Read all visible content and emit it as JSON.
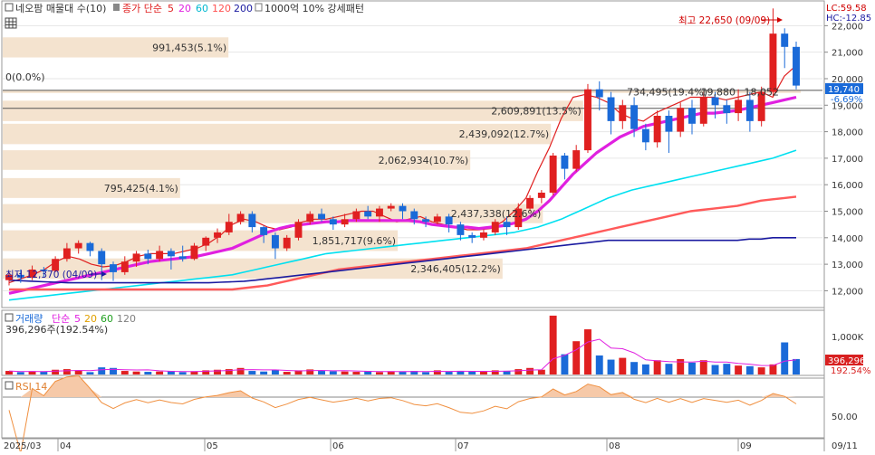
{
  "legend": {
    "ticker": "네오팜 매물대 수(10)",
    "ma_prefix": "종가 단순",
    "ma_periods": [
      "5",
      "20",
      "60",
      "120",
      "200"
    ],
    "ma_colors": [
      "#e02020",
      "#e020e0",
      "#00c8e0",
      "#ff5050",
      "#1a1aa0"
    ],
    "extra": "1000억 10% 강세패턴"
  },
  "corner": {
    "lc": "LC:59.58",
    "hc": "HC:-12.85"
  },
  "annotations": {
    "high": "최고 22,650 (09/09)",
    "low": "최저 12,370 (04/09)",
    "zero_profile": "0(0.0%)"
  },
  "price_badge": {
    "price": "19,740",
    "change": "-6.69%"
  },
  "volume_badge": {
    "value": "396,296",
    "pct": "192.54%"
  },
  "volume_legend": {
    "label": "거래량",
    "ma_prefix": "단순",
    "periods": [
      "5",
      "20",
      "60",
      "120"
    ],
    "colors": [
      "#e020e0",
      "#e0a000",
      "#20a020",
      "#808080"
    ],
    "summary": "396,296주(192.54%)"
  },
  "rsi_legend": {
    "label": "RSI 14"
  },
  "volume_axis": [
    "1,000K"
  ],
  "rsi_axis": [
    "50.00"
  ],
  "x_axis": [
    "2025/03",
    "04",
    "05",
    "06",
    "07",
    "08",
    "09",
    "09/11"
  ],
  "chart_data": {
    "type": "candlestick",
    "y_axis_ticks": [
      12000,
      13000,
      14000,
      15000,
      16000,
      17000,
      18000,
      19000,
      20000,
      21000,
      22000
    ],
    "ylim": [
      11400,
      22900
    ],
    "volume_profile": [
      {
        "label": "991,453(5.1%)",
        "y_from": 20800,
        "y_to": 21560,
        "width": 0.28
      },
      {
        "label": "734,495(19.4%)",
        "y_from": 19460,
        "y_to": 19560,
        "width": 0.99
      },
      {
        "label": "19,880",
        "y_from": 19460,
        "y_to": 19560,
        "width": 0.0
      },
      {
        "label": "18,052",
        "y_from": 19460,
        "y_to": 19560,
        "width": 0.0
      },
      {
        "label": "2,609,891(13.5%)",
        "y_from": 18400,
        "y_to": 19170,
        "width": 0.72
      },
      {
        "label": "2,439,092(12.7%)",
        "y_from": 17530,
        "y_to": 18300,
        "width": 0.68
      },
      {
        "label": "2,062,934(10.7%)",
        "y_from": 16560,
        "y_to": 17300,
        "width": 0.58
      },
      {
        "label": "795,425(4.1%)",
        "y_from": 15500,
        "y_to": 16250,
        "width": 0.22
      },
      {
        "label": "2,437,338(12.6%)",
        "y_from": 14550,
        "y_to": 15270,
        "width": 0.67
      },
      {
        "label": "1,851,717(9.6%)",
        "y_from": 13500,
        "y_to": 14280,
        "width": 0.49
      },
      {
        "label": "2,346,405(12.2%)",
        "y_from": 12450,
        "y_to": 13220,
        "width": 0.62
      }
    ],
    "box_levels": [
      19560,
      18880
    ],
    "series": [
      {
        "name": "5",
        "color": "#e02020",
        "values": [
          12300,
          12450,
          12600,
          12800,
          13100,
          13300,
          13200,
          13000,
          12900,
          12950,
          13100,
          13300,
          13400,
          13400,
          13400,
          13500,
          13600,
          13800,
          14100,
          14500,
          14700,
          14600,
          14400,
          14300,
          14400,
          14600,
          14700,
          14700,
          14800,
          14900,
          15000,
          15000,
          14800,
          14600,
          14700,
          14800,
          14600,
          14500,
          14400,
          14300,
          14300,
          14350,
          14600,
          15000,
          15500,
          16500,
          17400,
          18500,
          19300,
          19400,
          19300,
          19100,
          18700,
          18500,
          18400,
          18700,
          18900,
          19100,
          19300,
          19300,
          19300,
          19200,
          19300,
          19400,
          19500,
          19300,
          20100,
          20500
        ]
      },
      {
        "name": "20",
        "color": "#e020e0",
        "values": [
          11900,
          12000,
          12100,
          12200,
          12300,
          12400,
          12500,
          12600,
          12700,
          12800,
          12900,
          13000,
          13100,
          13150,
          13200,
          13250,
          13300,
          13400,
          13500,
          13600,
          13800,
          14000,
          14200,
          14350,
          14450,
          14500,
          14550,
          14600,
          14600,
          14650,
          14650,
          14650,
          14650,
          14650,
          14650,
          14600,
          14500,
          14450,
          14400,
          14400,
          14350,
          14400,
          14450,
          14550,
          14700,
          15000,
          15400,
          15900,
          16400,
          16800,
          17200,
          17500,
          17800,
          18000,
          18200,
          18300,
          18400,
          18500,
          18600,
          18700,
          18700,
          18750,
          18800,
          18900,
          19000,
          19100,
          19200,
          19300
        ]
      },
      {
        "name": "60",
        "color": "#00e0f0",
        "values": [
          11650,
          11700,
          11750,
          11800,
          11850,
          11900,
          11950,
          12000,
          12050,
          12100,
          12150,
          12200,
          12250,
          12300,
          12350,
          12400,
          12450,
          12500,
          12550,
          12600,
          12700,
          12800,
          12900,
          13000,
          13100,
          13200,
          13300,
          13400,
          13450,
          13500,
          13550,
          13600,
          13650,
          13700,
          13750,
          13800,
          13850,
          13900,
          13950,
          14000,
          14050,
          14100,
          14150,
          14200,
          14300,
          14400,
          14550,
          14700,
          14900,
          15100,
          15300,
          15500,
          15650,
          15800,
          15900,
          16000,
          16100,
          16200,
          16300,
          16400,
          16500,
          16600,
          16700,
          16800,
          16900,
          17000,
          17150,
          17300
        ]
      },
      {
        "name": "120",
        "color": "#ff5a5a",
        "values": [
          12050,
          12050,
          12050,
          12050,
          12050,
          12050,
          12050,
          12050,
          12050,
          12050,
          12050,
          12050,
          12050,
          12050,
          12050,
          12050,
          12050,
          12050,
          12050,
          12050,
          12100,
          12150,
          12200,
          12300,
          12400,
          12500,
          12600,
          12700,
          12800,
          12850,
          12900,
          12950,
          13000,
          13050,
          13100,
          13150,
          13200,
          13250,
          13300,
          13350,
          13400,
          13450,
          13500,
          13550,
          13600,
          13700,
          13800,
          13900,
          14000,
          14100,
          14200,
          14300,
          14400,
          14500,
          14600,
          14700,
          14800,
          14900,
          15000,
          15050,
          15100,
          15150,
          15200,
          15300,
          15400,
          15450,
          15500,
          15550
        ]
      },
      {
        "name": "200",
        "color": "#1a1aa0",
        "values": [
          12400,
          12380,
          12360,
          12340,
          12320,
          12300,
          12300,
          12300,
          12300,
          12300,
          12300,
          12300,
          12300,
          12300,
          12300,
          12300,
          12300,
          12300,
          12320,
          12340,
          12360,
          12400,
          12450,
          12500,
          12550,
          12600,
          12650,
          12700,
          12750,
          12800,
          12850,
          12900,
          12950,
          13000,
          13050,
          13100,
          13150,
          13200,
          13250,
          13300,
          13350,
          13400,
          13450,
          13500,
          13550,
          13600,
          13650,
          13700,
          13750,
          13800,
          13850,
          13900,
          13900,
          13900,
          13900,
          13900,
          13900,
          13900,
          13900,
          13900,
          13900,
          13900,
          13900,
          13950,
          13950,
          14000,
          14000,
          14000
        ]
      }
    ],
    "candles": [
      {
        "o": 12400,
        "c": 12600,
        "h": 12700,
        "l": 12200
      },
      {
        "o": 12600,
        "c": 12500,
        "h": 12800,
        "l": 12300
      },
      {
        "o": 12500,
        "c": 12800,
        "h": 12950,
        "l": 12400
      },
      {
        "o": 12800,
        "c": 12750,
        "h": 12900,
        "l": 12500
      },
      {
        "o": 12750,
        "c": 13200,
        "h": 13300,
        "l": 12700
      },
      {
        "o": 13200,
        "c": 13600,
        "h": 13800,
        "l": 13100
      },
      {
        "o": 13600,
        "c": 13800,
        "h": 13900,
        "l": 13400
      },
      {
        "o": 13800,
        "c": 13500,
        "h": 13850,
        "l": 13300
      },
      {
        "o": 13500,
        "c": 13000,
        "h": 13600,
        "l": 12400
      },
      {
        "o": 13000,
        "c": 12700,
        "h": 13100,
        "l": 12370
      },
      {
        "o": 12700,
        "c": 13100,
        "h": 13300,
        "l": 12600
      },
      {
        "o": 13100,
        "c": 13400,
        "h": 13500,
        "l": 12900
      },
      {
        "o": 13400,
        "c": 13200,
        "h": 13550,
        "l": 13000
      },
      {
        "o": 13200,
        "c": 13500,
        "h": 13700,
        "l": 13100
      },
      {
        "o": 13500,
        "c": 13300,
        "h": 13600,
        "l": 12800
      },
      {
        "o": 13300,
        "c": 13200,
        "h": 13700,
        "l": 13100
      },
      {
        "o": 13200,
        "c": 13700,
        "h": 13800,
        "l": 13150
      },
      {
        "o": 13700,
        "c": 14000,
        "h": 14050,
        "l": 13500
      },
      {
        "o": 14000,
        "c": 14200,
        "h": 14350,
        "l": 13800
      },
      {
        "o": 14200,
        "c": 14600,
        "h": 14900,
        "l": 14100
      },
      {
        "o": 14600,
        "c": 14900,
        "h": 15000,
        "l": 14500
      },
      {
        "o": 14900,
        "c": 14400,
        "h": 15000,
        "l": 14200
      },
      {
        "o": 14400,
        "c": 14100,
        "h": 14450,
        "l": 13800
      },
      {
        "o": 14100,
        "c": 13600,
        "h": 14200,
        "l": 13200
      },
      {
        "o": 13600,
        "c": 14000,
        "h": 14100,
        "l": 13500
      },
      {
        "o": 14000,
        "c": 14600,
        "h": 14700,
        "l": 13900
      },
      {
        "o": 14600,
        "c": 14900,
        "h": 15000,
        "l": 14500
      },
      {
        "o": 14900,
        "c": 14700,
        "h": 15100,
        "l": 14600
      },
      {
        "o": 14700,
        "c": 14500,
        "h": 14800,
        "l": 14300
      },
      {
        "o": 14500,
        "c": 14700,
        "h": 14900,
        "l": 14400
      },
      {
        "o": 14700,
        "c": 15000,
        "h": 15100,
        "l": 14600
      },
      {
        "o": 15000,
        "c": 14800,
        "h": 15200,
        "l": 14700
      },
      {
        "o": 14800,
        "c": 15100,
        "h": 15200,
        "l": 14600
      },
      {
        "o": 15100,
        "c": 15200,
        "h": 15300,
        "l": 15000
      },
      {
        "o": 15200,
        "c": 15000,
        "h": 15300,
        "l": 14700
      },
      {
        "o": 15000,
        "c": 14700,
        "h": 15100,
        "l": 14500
      },
      {
        "o": 14700,
        "c": 14600,
        "h": 14800,
        "l": 14400
      },
      {
        "o": 14600,
        "c": 14800,
        "h": 14900,
        "l": 14500
      },
      {
        "o": 14800,
        "c": 14500,
        "h": 14900,
        "l": 14200
      },
      {
        "o": 14500,
        "c": 14100,
        "h": 14600,
        "l": 13900
      },
      {
        "o": 14100,
        "c": 14000,
        "h": 14200,
        "l": 13800
      },
      {
        "o": 14000,
        "c": 14200,
        "h": 14300,
        "l": 13900
      },
      {
        "o": 14200,
        "c": 14600,
        "h": 14700,
        "l": 14100
      },
      {
        "o": 14600,
        "c": 14400,
        "h": 14800,
        "l": 14100
      },
      {
        "o": 14400,
        "c": 15100,
        "h": 15300,
        "l": 14300
      },
      {
        "o": 15100,
        "c": 15500,
        "h": 15600,
        "l": 15000
      },
      {
        "o": 15500,
        "c": 15700,
        "h": 15800,
        "l": 15300
      },
      {
        "o": 15700,
        "c": 17100,
        "h": 17200,
        "l": 15600
      },
      {
        "o": 17100,
        "c": 16600,
        "h": 17200,
        "l": 16200
      },
      {
        "o": 16600,
        "c": 17300,
        "h": 17500,
        "l": 16500
      },
      {
        "o": 17300,
        "c": 19600,
        "h": 19800,
        "l": 17200
      },
      {
        "o": 19600,
        "c": 19300,
        "h": 19900,
        "l": 18800
      },
      {
        "o": 19300,
        "c": 18400,
        "h": 19500,
        "l": 17900
      },
      {
        "o": 18400,
        "c": 19000,
        "h": 19200,
        "l": 18100
      },
      {
        "o": 19000,
        "c": 18100,
        "h": 19300,
        "l": 17800
      },
      {
        "o": 18100,
        "c": 17600,
        "h": 18300,
        "l": 17300
      },
      {
        "o": 17600,
        "c": 18600,
        "h": 18800,
        "l": 17400
      },
      {
        "o": 18600,
        "c": 18000,
        "h": 18800,
        "l": 17200
      },
      {
        "o": 18000,
        "c": 18900,
        "h": 19100,
        "l": 17800
      },
      {
        "o": 18900,
        "c": 18300,
        "h": 19200,
        "l": 17900
      },
      {
        "o": 18300,
        "c": 19300,
        "h": 19500,
        "l": 18200
      },
      {
        "o": 19300,
        "c": 19000,
        "h": 19500,
        "l": 18500
      },
      {
        "o": 19000,
        "c": 18700,
        "h": 19200,
        "l": 18300
      },
      {
        "o": 18700,
        "c": 19200,
        "h": 19600,
        "l": 18400
      },
      {
        "o": 19200,
        "c": 18400,
        "h": 19500,
        "l": 18000
      },
      {
        "o": 18400,
        "c": 19500,
        "h": 19700,
        "l": 18200
      },
      {
        "o": 19500,
        "c": 21700,
        "h": 22650,
        "l": 19300
      },
      {
        "o": 21700,
        "c": 21200,
        "h": 21900,
        "l": 20400
      },
      {
        "o": 21200,
        "c": 19740,
        "h": 21400,
        "l": 19600
      }
    ],
    "volume": [
      60,
      40,
      55,
      45,
      80,
      90,
      70,
      40,
      120,
      110,
      60,
      50,
      45,
      50,
      60,
      40,
      55,
      70,
      80,
      90,
      110,
      60,
      50,
      80,
      45,
      70,
      85,
      60,
      55,
      50,
      45,
      60,
      40,
      55,
      45,
      60,
      40,
      70,
      45,
      60,
      50,
      45,
      70,
      55,
      90,
      110,
      80,
      990,
      340,
      560,
      760,
      320,
      250,
      280,
      210,
      170,
      240,
      180,
      260,
      200,
      240,
      160,
      180,
      150,
      140,
      120,
      170,
      540,
      260
    ]
  }
}
